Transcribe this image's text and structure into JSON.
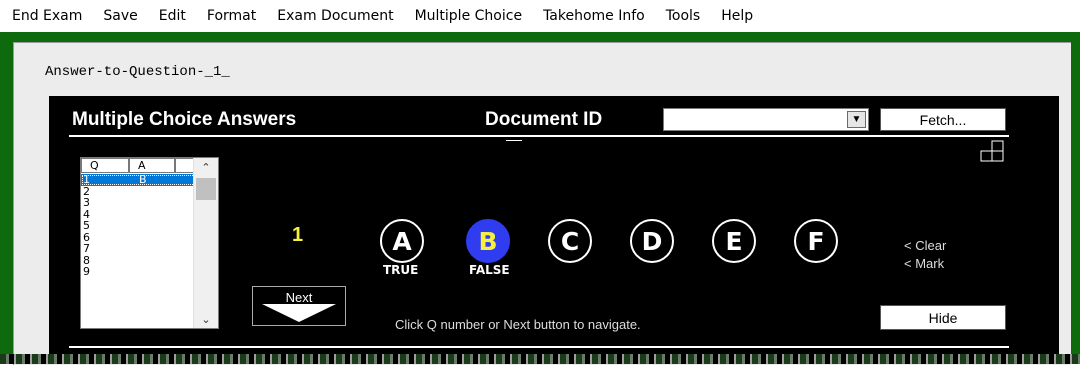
{
  "menu": [
    "End Exam",
    "Save",
    "Edit",
    "Format",
    "Exam Document",
    "Multiple Choice",
    "Takehome Info",
    "Tools",
    "Help"
  ],
  "document": {
    "title": "Answer-to-Question-_1_"
  },
  "panel": {
    "title": "Multiple Choice Answers",
    "document_id_label": "Document ID",
    "document_id_value": "",
    "fetch_label": "Fetch...",
    "hide_label": "Hide",
    "nav_hint": "Click Q number or Next button to navigate.",
    "next_label": "Next",
    "clear_label": "< Clear",
    "mark_label": "< Mark"
  },
  "qa_list": {
    "headers": [
      "Q",
      "A"
    ],
    "rows": [
      {
        "q": "1",
        "a": "B",
        "selected": true
      },
      {
        "q": "2",
        "a": ""
      },
      {
        "q": "3",
        "a": ""
      },
      {
        "q": "4",
        "a": ""
      },
      {
        "q": "5",
        "a": ""
      },
      {
        "q": "6",
        "a": ""
      },
      {
        "q": "7",
        "a": ""
      },
      {
        "q": "8",
        "a": ""
      },
      {
        "q": "9",
        "a": ""
      }
    ]
  },
  "current_question": "1",
  "choices": [
    {
      "letter": "A",
      "label": "TRUE",
      "selected": false
    },
    {
      "letter": "B",
      "label": "FALSE",
      "selected": true
    },
    {
      "letter": "C",
      "label": "",
      "selected": false
    },
    {
      "letter": "D",
      "label": "",
      "selected": false
    },
    {
      "letter": "E",
      "label": "",
      "selected": false
    },
    {
      "letter": "F",
      "label": "",
      "selected": false
    }
  ],
  "colors": {
    "frame_green": "#0d6b0d",
    "selected_choice": "#2f3cf0",
    "question_number": "#f5f13a",
    "list_selection": "#0078d7"
  }
}
